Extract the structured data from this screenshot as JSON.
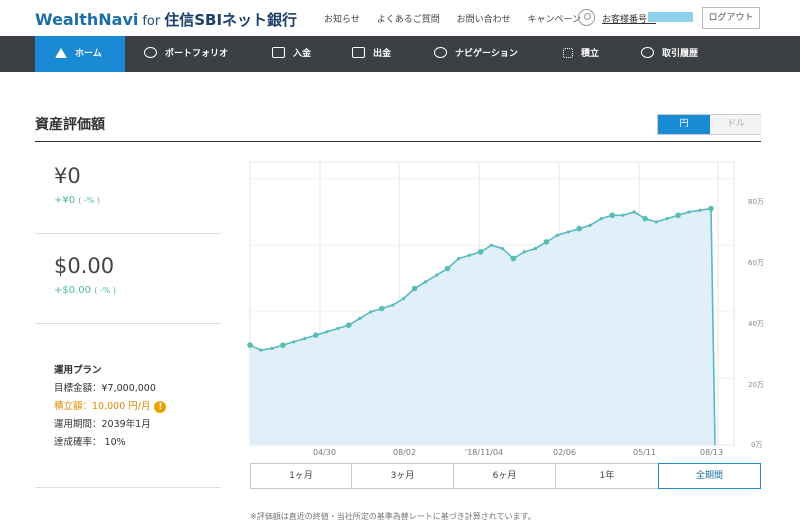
{
  "header": {
    "brand": "WealthNavi",
    "brand_for": "for",
    "bank": "住信SBIネット銀行",
    "links": [
      "お知らせ",
      "よくあるご質問",
      "お問い合わせ",
      "キャンペーン"
    ],
    "customer_label": "お客様番号：",
    "logout": "ログアウト",
    "colors": {
      "brand": "#1b6fa8",
      "nav_bg": "#3c3f43",
      "accent": "#1a8ad4"
    }
  },
  "nav": {
    "items": [
      {
        "label": "ホーム",
        "icon": "home-icon",
        "active": true
      },
      {
        "label": "ポートフォリオ",
        "icon": "pie-chart-icon"
      },
      {
        "label": "入金",
        "icon": "deposit-icon"
      },
      {
        "label": "出金",
        "icon": "withdraw-icon"
      },
      {
        "label": "ナビゲーション",
        "icon": "clock-icon"
      },
      {
        "label": "積立",
        "icon": "grid-icon"
      },
      {
        "label": "取引履歴",
        "icon": "history-icon"
      }
    ]
  },
  "main": {
    "title": "資産評価額",
    "currency_toggle": {
      "yen": "円",
      "dollar": "ドル",
      "selected": "円"
    }
  },
  "sidebar": {
    "yen_value": "¥0",
    "yen_change": "+¥0",
    "yen_change_pct": "( -% )",
    "usd_value": "$0.00",
    "usd_change": "+$0.00",
    "usd_change_pct": "( -% )",
    "plan_heading": "運用プラン",
    "plan_target": "目標金額：¥7,000,000",
    "plan_monthly": "積立額：10,000 円/月",
    "plan_period": "運用期間：2039年1月",
    "plan_probability": "達成確率： 10%"
  },
  "periods": {
    "items": [
      "1ヶ月",
      "3ヶ月",
      "6ヶ月",
      "1年",
      "全期間"
    ],
    "active": "全期間"
  },
  "footnote": "※評価額は直近の終値・当社所定の基準為替レートに基づき計算されています。",
  "chart_data": {
    "type": "area",
    "xlabel": "",
    "ylabel": "",
    "x_ticks": [
      "04/30",
      "08/02",
      "'18/11/04",
      "02/06",
      "05/11",
      "08/13"
    ],
    "y_ticks": [
      "0万",
      "20万",
      "40万",
      "60万",
      "80万"
    ],
    "ylim": [
      0,
      85
    ],
    "grid": true,
    "series": [
      {
        "values": [
          30,
          28.5,
          29,
          30,
          31,
          32,
          33,
          34,
          35,
          36,
          38,
          40,
          41,
          42,
          44,
          47,
          49,
          51,
          53,
          56,
          57,
          58,
          60,
          59,
          56,
          58,
          59,
          61,
          63,
          64,
          65,
          66,
          68,
          69,
          69,
          70,
          68,
          67,
          68,
          69,
          70,
          70.5,
          71,
          0
        ]
      }
    ]
  }
}
